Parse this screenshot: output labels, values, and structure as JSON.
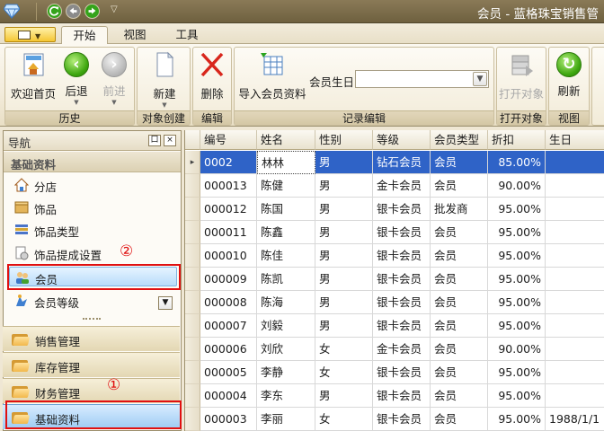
{
  "window": {
    "title": "会员 - 蓝格珠宝销售管"
  },
  "ribbon_tabs": [
    "开始",
    "视图",
    "工具"
  ],
  "ribbon_groups": {
    "history": {
      "label": "历史",
      "buttons": {
        "home": "欢迎首页",
        "back": "后退",
        "forward": "前进"
      }
    },
    "create": {
      "label": "对象创建",
      "new": "新建"
    },
    "edit": {
      "label": "编辑",
      "delete": "删除"
    },
    "record_edit": {
      "label": "记录编辑",
      "import": "导入会员资料",
      "birthday_label": "会员生日",
      "birthday_value": ""
    },
    "open": {
      "label": "打开对象",
      "open_object": "打开对象"
    },
    "view": {
      "label": "视图",
      "refresh": "刷新"
    }
  },
  "nav": {
    "title": "导航",
    "pin": "口",
    "close": "×",
    "section": "基础资料",
    "items": [
      "分店",
      "饰品",
      "饰品类型",
      "饰品提成设置",
      "会员",
      "会员等级"
    ],
    "selected_index": 4,
    "bottom_groups": [
      "销售管理",
      "库存管理",
      "财务管理",
      "基础资料"
    ],
    "active_group_index": 3
  },
  "annotations": {
    "marker1": "①",
    "marker2": "②"
  },
  "grid": {
    "columns": [
      "编号",
      "姓名",
      "性别",
      "等级",
      "会员类型",
      "折扣",
      "生日"
    ],
    "rows": [
      {
        "id": "0002",
        "name": "林林",
        "gender": "男",
        "level": "钻石会员",
        "type": "会员",
        "discount": "85.00%",
        "birthday": ""
      },
      {
        "id": "000013",
        "name": "陈健",
        "gender": "男",
        "level": "金卡会员",
        "type": "会员",
        "discount": "90.00%",
        "birthday": ""
      },
      {
        "id": "000012",
        "name": "陈国",
        "gender": "男",
        "level": "银卡会员",
        "type": "批发商",
        "discount": "95.00%",
        "birthday": ""
      },
      {
        "id": "000011",
        "name": "陈鑫",
        "gender": "男",
        "level": "银卡会员",
        "type": "会员",
        "discount": "95.00%",
        "birthday": ""
      },
      {
        "id": "000010",
        "name": "陈佳",
        "gender": "男",
        "level": "银卡会员",
        "type": "会员",
        "discount": "95.00%",
        "birthday": ""
      },
      {
        "id": "000009",
        "name": "陈凯",
        "gender": "男",
        "level": "银卡会员",
        "type": "会员",
        "discount": "95.00%",
        "birthday": ""
      },
      {
        "id": "000008",
        "name": "陈海",
        "gender": "男",
        "level": "银卡会员",
        "type": "会员",
        "discount": "95.00%",
        "birthday": ""
      },
      {
        "id": "000007",
        "name": "刘毅",
        "gender": "男",
        "level": "银卡会员",
        "type": "会员",
        "discount": "95.00%",
        "birthday": ""
      },
      {
        "id": "000006",
        "name": "刘欣",
        "gender": "女",
        "level": "金卡会员",
        "type": "会员",
        "discount": "90.00%",
        "birthday": ""
      },
      {
        "id": "000005",
        "name": "李静",
        "gender": "女",
        "level": "银卡会员",
        "type": "会员",
        "discount": "95.00%",
        "birthday": ""
      },
      {
        "id": "000004",
        "name": "李东",
        "gender": "男",
        "level": "银卡会员",
        "type": "会员",
        "discount": "95.00%",
        "birthday": ""
      },
      {
        "id": "000003",
        "name": "李丽",
        "gender": "女",
        "level": "银卡会员",
        "type": "会员",
        "discount": "95.00%",
        "birthday": "1988/1/1"
      }
    ],
    "selected_row": 0
  },
  "icons": {
    "app": "diamond-icon",
    "qa_refresh": "refresh-icon",
    "qa_back": "back-icon",
    "qa_forward": "forward-icon",
    "qa_customize": "chevron-down-icon"
  }
}
